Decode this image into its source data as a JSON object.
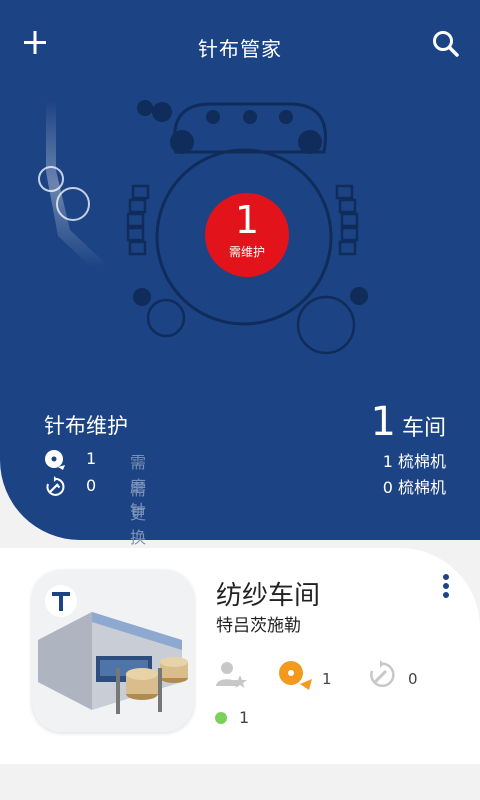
{
  "header": {
    "title": "针布管家",
    "add_icon": "plus-icon",
    "search_icon": "search-icon"
  },
  "status_badge": {
    "count": "1",
    "label": "需维护"
  },
  "summary": {
    "title": "针布维护",
    "rows": [
      {
        "icon": "grind-needle-icon",
        "count": "1",
        "label": "需磨针"
      },
      {
        "icon": "replace-icon",
        "count": "0",
        "label": "需更换"
      }
    ],
    "workshop_count": "1",
    "workshop_label": "车间",
    "machine_lines": [
      "1 梳棉机",
      "0 梳棉机"
    ]
  },
  "workshop_card": {
    "name": "纺纱车间",
    "subtitle": "特吕茨施勒",
    "logo_letter": "T",
    "stats": {
      "users_icon": "user-star-icon",
      "grind_count": "1",
      "replace_count": "0",
      "online_count": "1"
    }
  },
  "colors": {
    "hero_blue": "#1c4384",
    "alert_red": "#e3131b",
    "warning_orange": "#f39a1e",
    "online_green": "#7bd05a"
  }
}
